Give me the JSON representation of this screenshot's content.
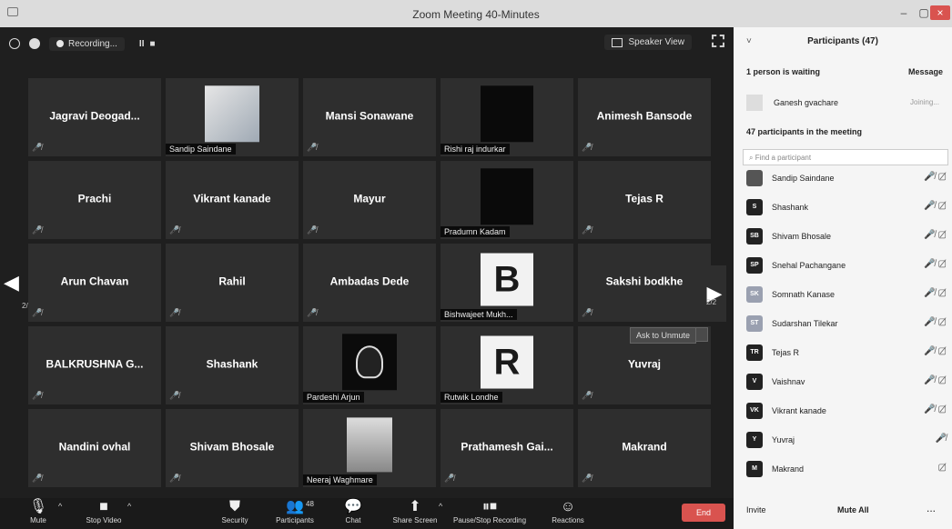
{
  "window": {
    "title": "Zoom Meeting 40-Minutes"
  },
  "topbar": {
    "recording_label": "Recording...",
    "pause_icon": "II",
    "stop_icon": "■",
    "speaker_view_label": "Speaker View"
  },
  "grid": {
    "tiles": [
      {
        "type": "name",
        "name": "Jagravi  Deogad..."
      },
      {
        "type": "photo",
        "photo": "light",
        "label": "Sandip Saindane"
      },
      {
        "type": "name",
        "name": "Mansi Sonawane"
      },
      {
        "type": "photo",
        "photo": "black",
        "label": "Rishi raj indurkar"
      },
      {
        "type": "name",
        "name": "Animesh Bansode"
      },
      {
        "type": "name",
        "name": "Prachi"
      },
      {
        "type": "name",
        "name": "Vikrant kanade"
      },
      {
        "type": "name",
        "name": "Mayur"
      },
      {
        "type": "photo",
        "photo": "black",
        "label": "Pradumn Kadam"
      },
      {
        "type": "name",
        "name": "Tejas R"
      },
      {
        "type": "name",
        "name": "Arun Chavan"
      },
      {
        "type": "name",
        "name": "Rahil"
      },
      {
        "type": "name",
        "name": "Ambadas Dede"
      },
      {
        "type": "photo",
        "photo": "avatar",
        "letter": "B",
        "label": "Bishwajeet Mukh..."
      },
      {
        "type": "name",
        "name": "Sakshi bodkhe"
      },
      {
        "type": "name",
        "name": "BALKRUSHNA G..."
      },
      {
        "type": "name",
        "name": "Shashank"
      },
      {
        "type": "photo",
        "photo": "hood",
        "label": "Pardeshi Arjun"
      },
      {
        "type": "photo",
        "photo": "avatar",
        "letter": "R",
        "label": "Rutwik Londhe"
      },
      {
        "type": "name",
        "name": "Yuvraj"
      },
      {
        "type": "name",
        "name": "Nandini ovhal"
      },
      {
        "type": "name",
        "name": "Shivam Bhosale"
      },
      {
        "type": "photo",
        "photo": "pubg",
        "label": "Neeraj Waghmare"
      },
      {
        "type": "name",
        "name": "Prathamesh  Gai..."
      },
      {
        "type": "name",
        "name": "Makrand"
      }
    ],
    "page_prev": "2/2",
    "page_next": "2/2",
    "ask_to_unmute": "Ask to Unmute"
  },
  "toolbar": {
    "mute": "Mute",
    "stop_video": "Stop Video",
    "security": "Security",
    "participants": "Participants",
    "participants_count": "48",
    "chat": "Chat",
    "share_screen": "Share Screen",
    "pause_stop_recording": "Pause/Stop Recording",
    "reactions": "Reactions",
    "end": "End"
  },
  "panel": {
    "title": "Participants (47)",
    "waiting_heading": "1 person is waiting",
    "message_all": "Message",
    "waiting_name": "Ganesh gvachare",
    "waiting_status": "Joining...",
    "in_meeting_heading": "47 participants in the meeting",
    "search_placeholder": "Find a participant",
    "participants": [
      {
        "initials": "",
        "name": "Sandip Saindane",
        "color": "#555555",
        "icons": "🎤̸ ▢̸"
      },
      {
        "initials": "S",
        "name": "Shashank",
        "color": "#222222",
        "icons": "🎤̸ ▢̸"
      },
      {
        "initials": "SB",
        "name": "Shivam Bhosale",
        "color": "#222222",
        "icons": "🎤̸ ▢̸"
      },
      {
        "initials": "SP",
        "name": "Snehal Pachangane",
        "color": "#222222",
        "icons": "🎤̸ ▢̸"
      },
      {
        "initials": "SK",
        "name": "Somnath Kanase",
        "color": "#9aa0b0",
        "icons": "🎤̸ ▢̸"
      },
      {
        "initials": "ST",
        "name": "Sudarshan Tilekar",
        "color": "#9aa0b0",
        "icons": "🎤̸ ▢̸"
      },
      {
        "initials": "TR",
        "name": "Tejas R",
        "color": "#222222",
        "icons": "🎤̸ ▢̸"
      },
      {
        "initials": "V",
        "name": "Vaishnav",
        "color": "#222222",
        "icons": "🎤̸ ▢̸"
      },
      {
        "initials": "VK",
        "name": "Vikrant kanade",
        "color": "#222222",
        "icons": "🎤̸ ▢̸"
      },
      {
        "initials": "Y",
        "name": "Yuvraj",
        "color": "#222222",
        "icons": "🎤̸"
      },
      {
        "initials": "M",
        "name": "Makrand",
        "color": "#222222",
        "icons": "▢̸"
      }
    ],
    "invite": "Invite",
    "mute_all": "Mute All",
    "more": "..."
  }
}
